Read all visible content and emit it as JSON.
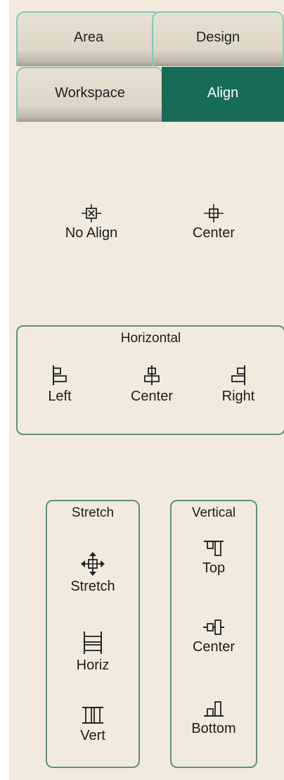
{
  "tabs": {
    "row1": [
      {
        "label": "Area",
        "active": false
      },
      {
        "label": "Design",
        "active": false
      }
    ],
    "row2": [
      {
        "label": "Workspace",
        "active": false
      },
      {
        "label": "Align",
        "active": true
      }
    ]
  },
  "colors": {
    "panel_background": "#f2ebdd",
    "active_tab": "#166c59",
    "tab_border": "#7fc9b6",
    "group_border": "#5f8f80"
  },
  "top_buttons": {
    "no_align": {
      "label": "No Align",
      "icon": "no-align-icon"
    },
    "center": {
      "label": "Center",
      "icon": "center-crosshair-icon"
    }
  },
  "horizontal": {
    "title": "Horizontal",
    "left": {
      "label": "Left",
      "icon": "align-left-icon"
    },
    "center": {
      "label": "Center",
      "icon": "align-center-horizontal-icon"
    },
    "right": {
      "label": "Right",
      "icon": "align-right-icon"
    }
  },
  "stretch": {
    "title": "Stretch",
    "stretch": {
      "label": "Stretch",
      "icon": "stretch-move-icon"
    },
    "horiz": {
      "label": "Horiz",
      "icon": "stretch-horizontal-icon"
    },
    "vert": {
      "label": "Vert",
      "icon": "stretch-vertical-icon"
    }
  },
  "vertical": {
    "title": "Vertical",
    "top": {
      "label": "Top",
      "icon": "align-top-icon"
    },
    "center": {
      "label": "Center",
      "icon": "align-center-vertical-icon"
    },
    "bottom": {
      "label": "Bottom",
      "icon": "align-bottom-icon"
    }
  }
}
